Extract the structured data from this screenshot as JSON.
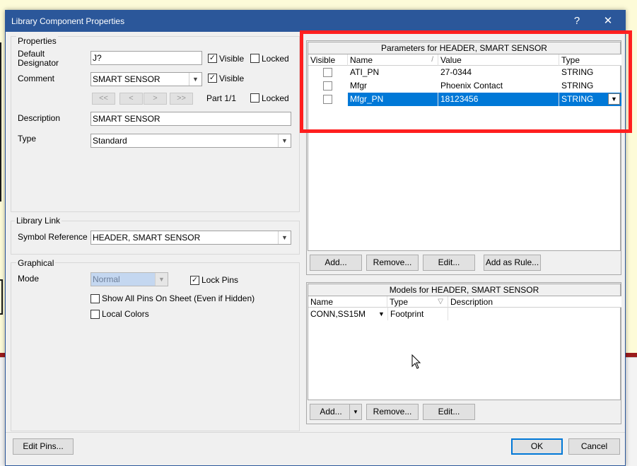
{
  "dialog": {
    "title": "Library Component Properties",
    "help_label": "?",
    "close_label": "✕"
  },
  "properties": {
    "legend": "Properties",
    "default_designator_label": "Default\nDesignator",
    "default_designator_value": "J?",
    "designator_visible_label": "Visible",
    "designator_visible_checked": true,
    "designator_locked_label": "Locked",
    "designator_locked_checked": false,
    "comment_label": "Comment",
    "comment_value": "SMART SENSOR",
    "comment_visible_label": "Visible",
    "comment_visible_checked": true,
    "nav_buttons": [
      "<<",
      "<",
      ">",
      ">>"
    ],
    "part_label": "Part 1/1",
    "part_locked_label": "Locked",
    "part_locked_checked": false,
    "description_label": "Description",
    "description_value": "SMART SENSOR",
    "type_label": "Type",
    "type_value": "Standard"
  },
  "library_link": {
    "legend": "Library Link",
    "symbol_reference_label": "Symbol Reference",
    "symbol_reference_value": "HEADER, SMART SENSOR"
  },
  "graphical": {
    "legend": "Graphical",
    "mode_label": "Mode",
    "mode_value": "Normal",
    "lock_pins_label": "Lock Pins",
    "lock_pins_checked": true,
    "show_all_pins_label": "Show All Pins On Sheet (Even if Hidden)",
    "show_all_pins_checked": false,
    "local_colors_label": "Local Colors",
    "local_colors_checked": false
  },
  "parameters": {
    "header": "Parameters for HEADER, SMART SENSOR",
    "columns": [
      "Visible",
      "Name",
      "Value",
      "Type"
    ],
    "rows": [
      {
        "visible": false,
        "name": "ATI_PN",
        "value": "27-0344",
        "type": "STRING",
        "selected": false
      },
      {
        "visible": false,
        "name": "Mfgr",
        "value": "Phoenix Contact",
        "type": "STRING",
        "selected": false
      },
      {
        "visible": false,
        "name": "Mfgr_PN",
        "value": "18123456",
        "type": "STRING",
        "selected": true
      }
    ],
    "buttons": {
      "add": "Add...",
      "remove": "Remove...",
      "edit": "Edit...",
      "add_as_rule": "Add as Rule..."
    }
  },
  "models": {
    "header": "Models for HEADER, SMART SENSOR",
    "columns": [
      "Name",
      "Type",
      "Description"
    ],
    "rows": [
      {
        "name": "CONN,SS15M",
        "type": "Footprint",
        "description": ""
      }
    ],
    "buttons": {
      "add": "Add...",
      "remove": "Remove...",
      "edit": "Edit..."
    }
  },
  "footer": {
    "edit_pins": "Edit Pins...",
    "ok": "OK",
    "cancel": "Cancel"
  },
  "colors": {
    "accent": "#2b579a",
    "selection": "#0078d7",
    "highlight": "#ff1f1f"
  }
}
